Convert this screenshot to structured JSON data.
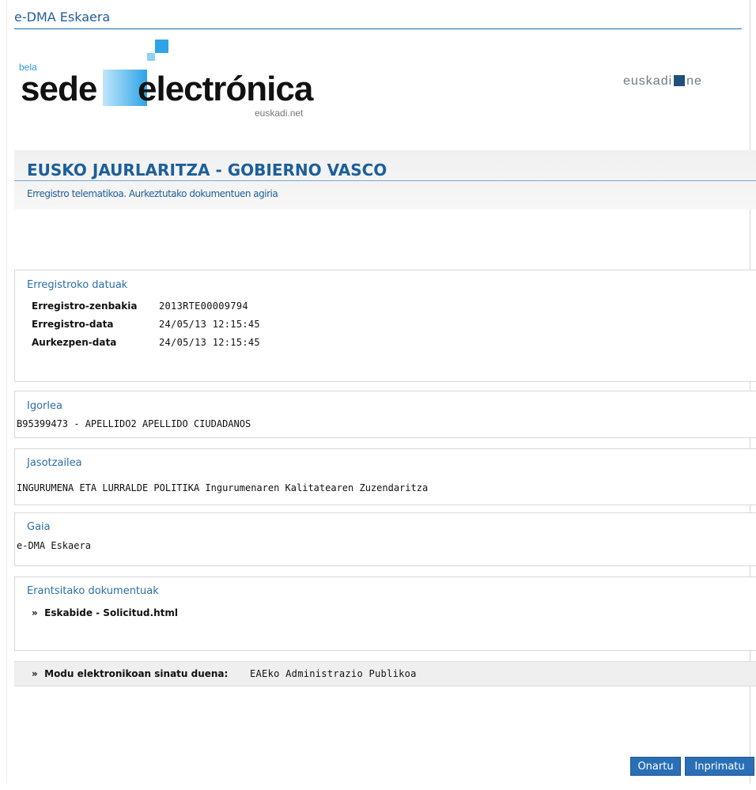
{
  "header": {
    "title": "e-DMA Eskaera",
    "logo": {
      "bela": "bela",
      "sede": "sede",
      "electronica": "electrónica",
      "euskadinet": "euskadi.net"
    },
    "euskadi_logo": {
      "left": "euskadi",
      "right": "ne"
    }
  },
  "government": {
    "title": "EUSKO JAURLARITZA - GOBIERNO VASCO",
    "subtitle": "Erregistro telematikoa. Aurkeztutako dokumentuen agiria"
  },
  "registry": {
    "legend": "Erregistroko datuak",
    "fields": [
      {
        "label": "Erregistro-zenbakia",
        "value": "2013RTE00009794"
      },
      {
        "label": "Erregistro-data",
        "value": "24/05/13 12:15:45"
      },
      {
        "label": "Aurkezpen-data",
        "value": "24/05/13 12:15:45"
      }
    ]
  },
  "sender": {
    "legend": "Igorlea",
    "value": "B95399473 - APELLIDO2 APELLIDO CIUDADANOS"
  },
  "recipient": {
    "legend": "Jasotzailea",
    "value": "INGURUMENA ETA LURRALDE POLITIKA  Ingurumenaren Kalitatearen Zuzendaritza"
  },
  "subject": {
    "legend": "Gaia",
    "value": "e-DMA Eskaera"
  },
  "documents": {
    "legend": "Erantsitako dokumentuak",
    "items": [
      {
        "bullet": "»",
        "label": "Eskabide - Solicitud.html"
      }
    ]
  },
  "signature": {
    "bullet": "»",
    "label": "Modu elektronikoan sinatu duena:",
    "value": "EAEko Administrazio Publikoa"
  },
  "buttons": {
    "accept": "Onartu",
    "print": "Inprimatu"
  }
}
